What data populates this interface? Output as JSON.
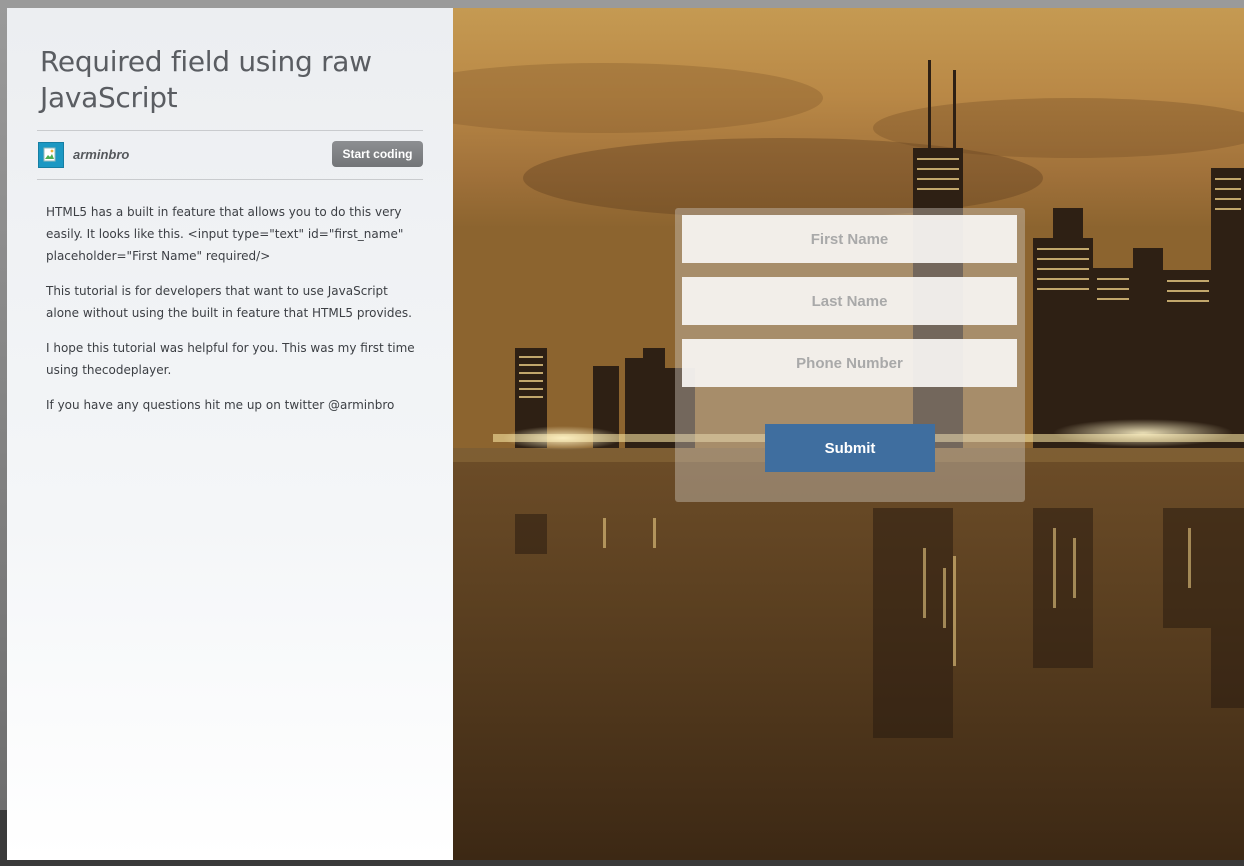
{
  "tutorial": {
    "title": "Required field using raw JavaScript",
    "author": "arminbro",
    "start_button": "Start coding",
    "paragraphs": [
      "HTML5 has a built in feature that allows you to do this very easily. It looks like this. <input type=\"text\" id=\"first_name\" placeholder=\"First Name\" required/>",
      "This tutorial is for developers that want to use JavaScript alone without using the built in feature that HTML5 provides.",
      "I hope this tutorial was helpful for you. This was my first time using thecodeplayer.",
      "If you have any questions hit me up on twitter @arminbro"
    ]
  },
  "form": {
    "first_name_placeholder": "First Name",
    "last_name_placeholder": "Last Name",
    "phone_placeholder": "Phone Number",
    "submit_label": "Submit"
  },
  "colors": {
    "submit_bg": "#3f6e9f",
    "start_button_bg": "#808285",
    "avatar_bg": "#1c98c3",
    "title_text": "#5a5d62"
  },
  "icons": {
    "avatar": "broken-image-icon"
  }
}
